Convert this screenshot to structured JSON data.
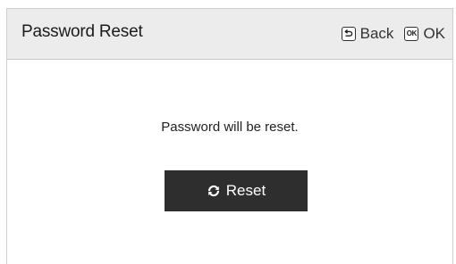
{
  "dialog": {
    "title": "Password Reset",
    "actions": [
      {
        "icon": "back-key-icon",
        "label": "Back"
      },
      {
        "icon": "ok-key-icon",
        "key_text": "OK",
        "label": "OK"
      }
    ],
    "message": "Password will be reset.",
    "reset_button": {
      "icon": "refresh-icon",
      "label": "Reset"
    }
  },
  "colors": {
    "header_bg": "#ececec",
    "button_bg": "#2e2e2e",
    "button_text": "#ffffff"
  }
}
